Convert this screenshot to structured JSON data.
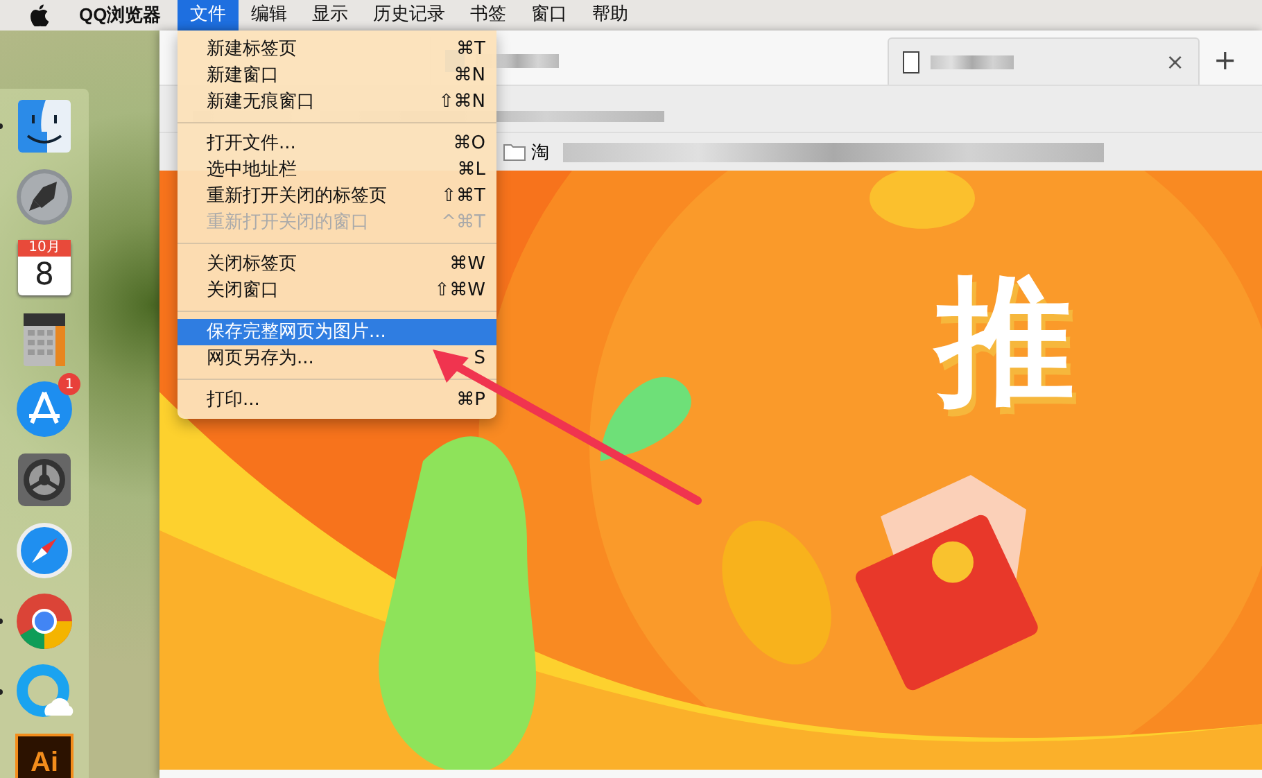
{
  "menu_bar": {
    "app_name": "QQ浏览器",
    "menus": [
      {
        "label": "文件",
        "selected": true
      },
      {
        "label": "编辑",
        "selected": false
      },
      {
        "label": "显示",
        "selected": false
      },
      {
        "label": "历史记录",
        "selected": false
      },
      {
        "label": "书签",
        "selected": false
      },
      {
        "label": "窗口",
        "selected": false
      },
      {
        "label": "帮助",
        "selected": false
      }
    ]
  },
  "file_menu": {
    "groups": [
      [
        {
          "label": "新建标签页",
          "shortcut": "⌘T",
          "disabled": false,
          "selected": false
        },
        {
          "label": "新建窗口",
          "shortcut": "⌘N",
          "disabled": false,
          "selected": false
        },
        {
          "label": "新建无痕窗口",
          "shortcut": "⇧⌘N",
          "disabled": false,
          "selected": false
        }
      ],
      [
        {
          "label": "打开文件...",
          "shortcut": "⌘O",
          "disabled": false,
          "selected": false
        },
        {
          "label": "选中地址栏",
          "shortcut": "⌘L",
          "disabled": false,
          "selected": false
        },
        {
          "label": "重新打开关闭的标签页",
          "shortcut": "⇧⌘T",
          "disabled": false,
          "selected": false
        },
        {
          "label": "重新打开关闭的窗口",
          "shortcut": "^⌘T",
          "disabled": true,
          "selected": false
        }
      ],
      [
        {
          "label": "关闭标签页",
          "shortcut": "⌘W",
          "disabled": false,
          "selected": false
        },
        {
          "label": "关闭窗口",
          "shortcut": "⇧⌘W",
          "disabled": false,
          "selected": false
        }
      ],
      [
        {
          "label": "保存完整网页为图片...",
          "disabled": false,
          "selected": true
        },
        {
          "label": "网页另存为...",
          "shortcut": "S",
          "disabled": false,
          "selected": false
        }
      ],
      [
        {
          "label": "打印...",
          "shortcut": "⌘P",
          "disabled": false,
          "selected": false
        }
      ]
    ]
  },
  "dock": {
    "items": [
      {
        "kind": "finder",
        "running": true
      },
      {
        "kind": "launchpad",
        "running": false
      },
      {
        "kind": "calendar",
        "running": false,
        "month": "10月",
        "day": "8"
      },
      {
        "kind": "calculator",
        "running": false
      },
      {
        "kind": "appstore",
        "running": false,
        "badge": "1"
      },
      {
        "kind": "preferences",
        "running": false
      },
      {
        "kind": "safari",
        "running": false
      },
      {
        "kind": "chrome",
        "running": true
      },
      {
        "kind": "qq",
        "running": true
      },
      {
        "kind": "illustrator",
        "running": false,
        "text": "Ai"
      }
    ]
  },
  "browser": {
    "tabs": [
      {
        "selected": false
      },
      {
        "selected": true,
        "close": "×"
      }
    ],
    "new_tab": "+",
    "bookmarks": [
      {
        "label": "淘"
      }
    ],
    "banner": {
      "headline": "推"
    }
  }
}
